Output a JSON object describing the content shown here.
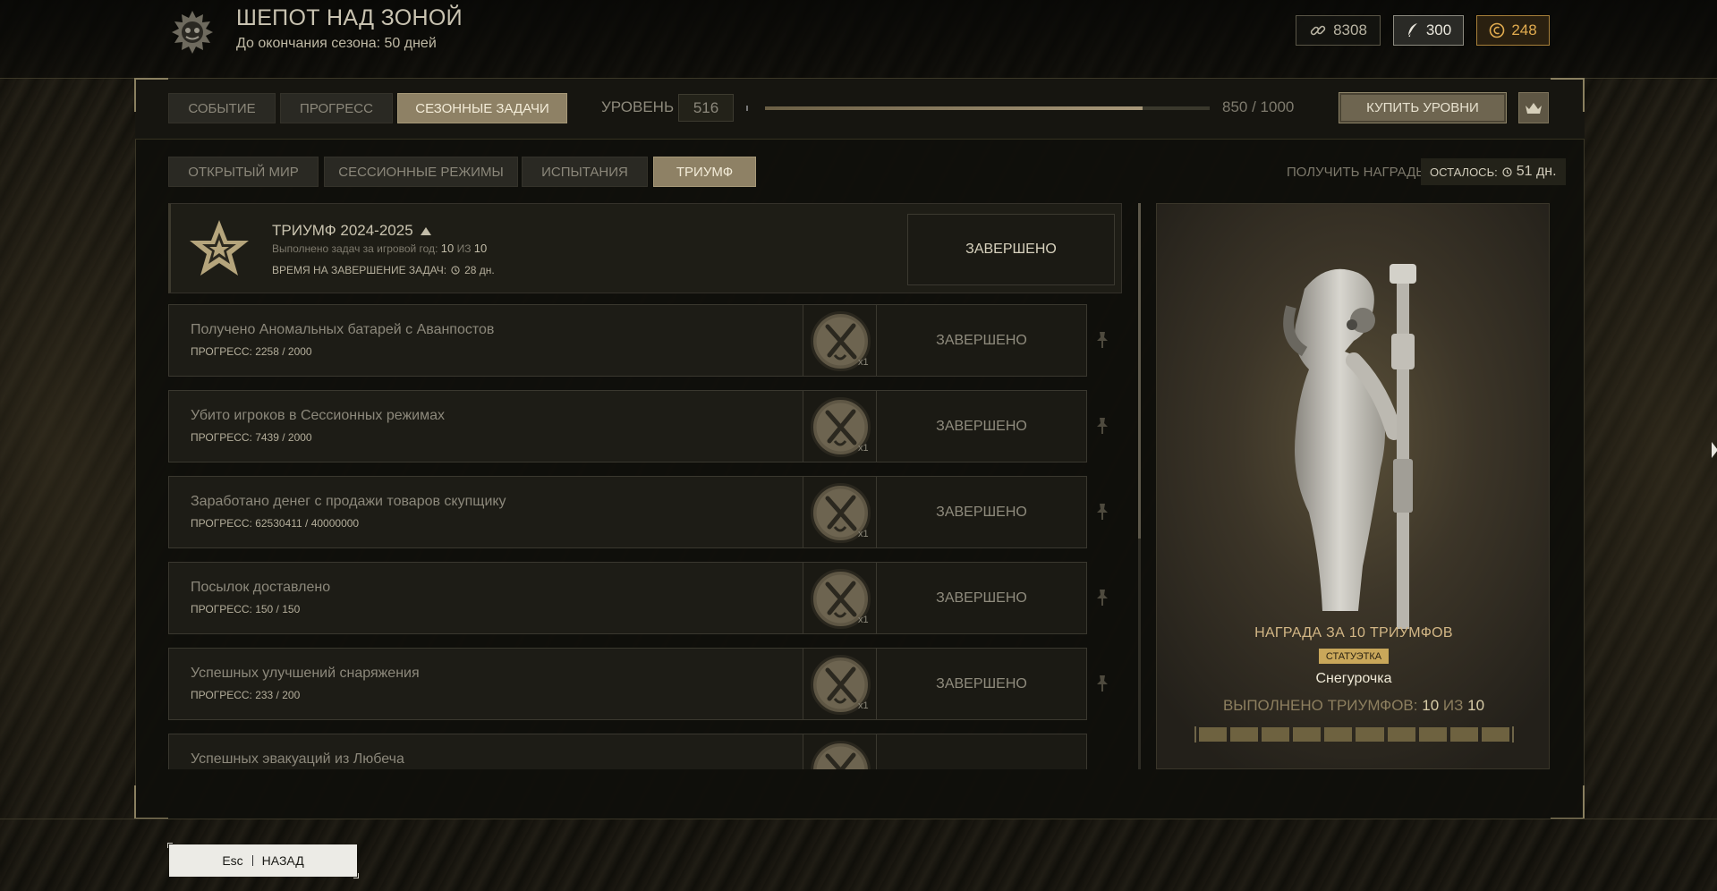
{
  "header": {
    "title": "ШЕПОТ НАД ЗОНОЙ",
    "season_remaining": "До окончания сезона: 50 дней",
    "currencies": [
      {
        "icon": "link-icon",
        "value": "8308"
      },
      {
        "icon": "feather-icon",
        "value": "300"
      },
      {
        "icon": "coin-icon",
        "value": "248",
        "color": "#e2ac4f"
      }
    ]
  },
  "top_tabs": [
    {
      "label": "СОБЫТИЕ",
      "active": false
    },
    {
      "label": "ПРОГРЕСС",
      "active": false
    },
    {
      "label": "СЕЗОННЫЕ ЗАДАЧИ",
      "active": true
    }
  ],
  "level": {
    "label": "УРОВЕНЬ",
    "value": "516",
    "progress_text": "850 / 1000",
    "progress_fraction": 0.85
  },
  "buy_levels_label": "КУПИТЬ УРОВНИ",
  "sub_tabs": [
    {
      "label": "ОТКРЫТЫЙ МИР",
      "active": false
    },
    {
      "label": "СЕССИОННЫЕ РЕЖИМЫ",
      "active": false
    },
    {
      "label": "ИСПЫТАНИЯ",
      "active": false
    },
    {
      "label": "ТРИУМФ",
      "active": true
    }
  ],
  "get_rewards_label": "ПОЛУЧИТЬ НАГРАДЫ",
  "remaining": {
    "label": "ОСТАЛОСЬ:",
    "value": "51 дн."
  },
  "triumph": {
    "title": "ТРИУМФ 2024-2025",
    "tasks_done_prefix": "Выполнено задач за игровой год:",
    "tasks_done_value": "10",
    "tasks_done_of": "ИЗ",
    "tasks_total": "10",
    "time_label": "ВРЕМЯ НА ЗАВЕРШЕНИЕ ЗАДАЧ:",
    "time_value": "28 дн.",
    "status": "ЗАВЕРШЕНО"
  },
  "tasks": [
    {
      "name": "Получено Аномальных батарей с Аванпостов",
      "progress": "ПРОГРЕСС: 2258 / 2000",
      "reward_qty": "x1",
      "status": "ЗАВЕРШЕНО"
    },
    {
      "name": "Убито игроков в Сессионных режимах",
      "progress": "ПРОГРЕСС: 7439 / 2000",
      "reward_qty": "x1",
      "status": "ЗАВЕРШЕНО"
    },
    {
      "name": "Заработано денег с продажи товаров скупщику",
      "progress": "ПРОГРЕСС: 62530411 / 40000000",
      "reward_qty": "x1",
      "status": "ЗАВЕРШЕНО"
    },
    {
      "name": "Посылок доставлено",
      "progress": "ПРОГРЕСС: 150 / 150",
      "reward_qty": "x1",
      "status": "ЗАВЕРШЕНО"
    },
    {
      "name": "Успешных улучшений снаряжения",
      "progress": "ПРОГРЕСС: 233 / 200",
      "reward_qty": "x1",
      "status": "ЗАВЕРШЕНО"
    },
    {
      "name": "Успешных эвакуаций из Любеча",
      "progress": "",
      "reward_qty": "",
      "status": ""
    }
  ],
  "reward": {
    "title": "НАГРАДА ЗА 10 ТРИУМФОВ",
    "type_badge": "СТАТУЭТКА",
    "name": "Снегурочка",
    "count_label": "ВЫПОЛНЕНО ТРИУМФОВ:",
    "count_done": "10",
    "count_of": "ИЗ",
    "count_total": "10",
    "segments_filled": 10,
    "segments_total": 10
  },
  "back": {
    "key": "Esc",
    "label": "НАЗАД"
  },
  "colors": {
    "accent": "#8e8165",
    "gold": "#c9a75a",
    "currency_gold": "#e2ac4f"
  }
}
